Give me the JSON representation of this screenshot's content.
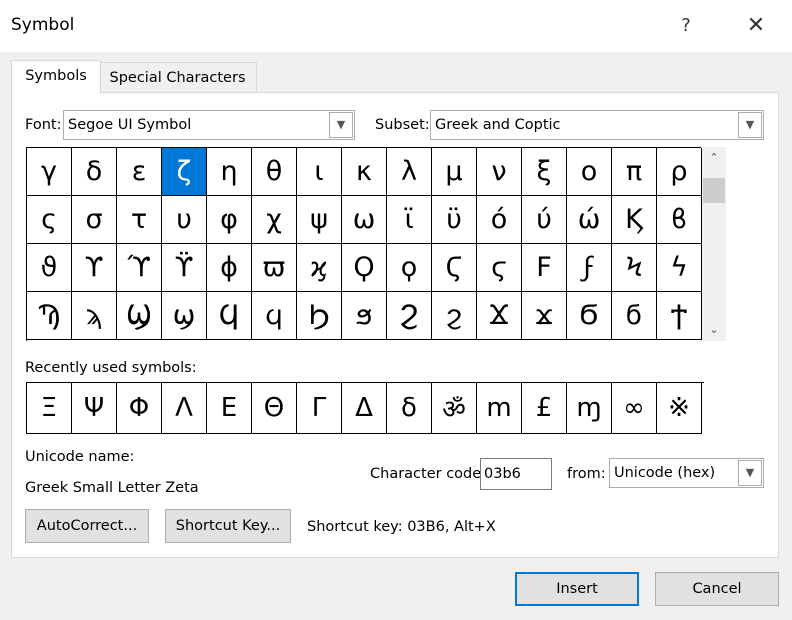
{
  "window": {
    "title": "Symbol",
    "help_glyph": "?",
    "close_glyph": "✕"
  },
  "tabs": [
    {
      "label": "Symbols",
      "active": true
    },
    {
      "label": "Special Characters",
      "active": false
    }
  ],
  "font": {
    "label": "Font:",
    "value": "Segoe UI Symbol"
  },
  "subset": {
    "label": "Subset:",
    "value": "Greek and Coptic"
  },
  "grid": {
    "rows": [
      [
        "γ",
        "δ",
        "ε",
        "ζ",
        "η",
        "θ",
        "ι",
        "κ",
        "λ",
        "μ",
        "ν",
        "ξ",
        "ο",
        "π",
        "ρ"
      ],
      [
        "ς",
        "σ",
        "τ",
        "υ",
        "φ",
        "χ",
        "ψ",
        "ω",
        "ϊ",
        "ϋ",
        "ό",
        "ύ",
        "ώ",
        "Ϗ",
        "ϐ"
      ],
      [
        "ϑ",
        "ϒ",
        "ϓ",
        "ϔ",
        "ϕ",
        "ϖ",
        "ϗ",
        "Ϙ",
        "ϙ",
        "Ϛ",
        "ϛ",
        "Ϝ",
        "ϝ",
        "Ϟ",
        "ϟ"
      ],
      [
        "Ϡ",
        "ϡ",
        "Ϣ",
        "ϣ",
        "Ϥ",
        "ϥ",
        "Ϧ",
        "ϧ",
        "Ϩ",
        "ϩ",
        "Ϫ",
        "ϫ",
        "Ϭ",
        "ϭ",
        "Ϯ"
      ]
    ],
    "selected": "ζ"
  },
  "scroll": {
    "up_glyph": "⌃",
    "down_glyph": "⌄"
  },
  "recent": {
    "label": "Recently used symbols:",
    "items": [
      "Ξ",
      "Ψ",
      "Φ",
      "Λ",
      "Ε",
      "Θ",
      "Γ",
      "Δ",
      "δ",
      "ॐ",
      "m",
      "£",
      "ɱ",
      "∞",
      "※"
    ]
  },
  "unicode": {
    "label": "Unicode name:",
    "value": "Greek Small Letter Zeta"
  },
  "char_code": {
    "label": "Character code:",
    "value": "03b6"
  },
  "from": {
    "label": "from:",
    "value": "Unicode (hex)"
  },
  "buttons": {
    "autocorrect": "AutoCorrect...",
    "shortcut": "Shortcut Key...",
    "insert": "Insert",
    "cancel": "Cancel"
  },
  "shortcut_text": "Shortcut key: 03B6, Alt+X"
}
